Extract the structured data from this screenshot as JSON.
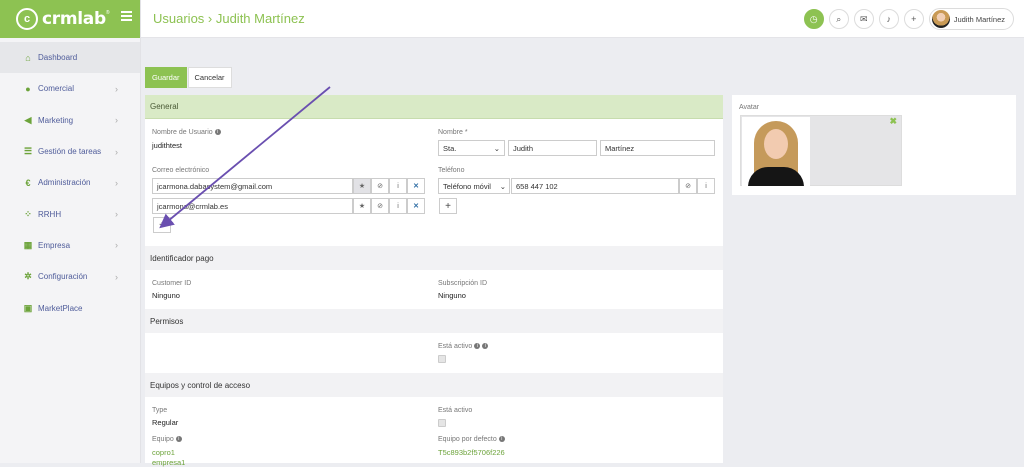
{
  "app": {
    "logo_text": "crmlab",
    "logo_mark": "c",
    "logo_reg": "®"
  },
  "sidebar": {
    "items": [
      {
        "label": "Dashboard",
        "icon": "home-icon",
        "glyph": "⌂",
        "active": true,
        "chevron": false
      },
      {
        "label": "Comercial",
        "icon": "users-icon",
        "glyph": "●",
        "active": false,
        "chevron": true
      },
      {
        "label": "Marketing",
        "icon": "megaphone-icon",
        "glyph": "◀",
        "active": false,
        "chevron": true
      },
      {
        "label": "Gestión de tareas",
        "icon": "list-icon",
        "glyph": "☰",
        "active": false,
        "chevron": true
      },
      {
        "label": "Administración",
        "icon": "euro-icon",
        "glyph": "€",
        "active": false,
        "chevron": true
      },
      {
        "label": "RRHH",
        "icon": "group-icon",
        "glyph": "⁘",
        "active": false,
        "chevron": true
      },
      {
        "label": "Empresa",
        "icon": "building-icon",
        "glyph": "▦",
        "active": false,
        "chevron": true
      },
      {
        "label": "Configuración",
        "icon": "gear-icon",
        "glyph": "✲",
        "active": false,
        "chevron": true
      },
      {
        "label": "MarketPlace",
        "icon": "bag-icon",
        "glyph": "▣",
        "active": false,
        "chevron": false
      }
    ],
    "chevron": "›"
  },
  "header": {
    "title": "Usuarios › Judith Martínez",
    "user_name": "Judith Martínez",
    "icons": {
      "clock": "◷",
      "search": "⌕",
      "mail": "✉",
      "bell": "♪",
      "add": "+"
    }
  },
  "toolbar": {
    "save_label": "Guardar",
    "cancel_label": "Cancelar"
  },
  "general": {
    "title": "General",
    "username_label": "Nombre de Usuario",
    "username": "judithtest",
    "name_label": "Nombre *",
    "salutation": "Sta.",
    "first_name": "Judith",
    "last_name": "Martínez",
    "email_label": "Correo electrónico",
    "emails": [
      "jcarmona.dabasystem@gmail.com",
      "jcarmona@crmlab.es"
    ],
    "phone_label": "Teléfono",
    "phone_type": "Teléfono móvil",
    "phone_number": "658 447 102",
    "add": "+",
    "btn_star": "★",
    "btn_ban": "⊘",
    "btn_info": "i",
    "btn_remove": "✕",
    "caret": "⌄"
  },
  "payment": {
    "title": "Identificador pago",
    "customer_label": "Customer ID",
    "customer_value": "Ninguno",
    "subscription_label": "Subscripción ID",
    "subscription_value": "Ninguno"
  },
  "permissions": {
    "title": "Permisos",
    "active_label": "Está activo"
  },
  "teams": {
    "title": "Equipos y control de acceso",
    "type_label": "Type",
    "type_value": "Regular",
    "active_label": "Está activo",
    "team_label": "Equipo",
    "teams": [
      "copro1",
      "empresa1"
    ],
    "default_team_label": "Equipo por defecto",
    "default_team_value": "T5c893b2f5706f226"
  },
  "avatar": {
    "label": "Avatar",
    "remove": "✖"
  },
  "colors": {
    "accent": "#8dc252",
    "nav_text": "#4f5c9a",
    "arrow": "#6a4fb0"
  }
}
